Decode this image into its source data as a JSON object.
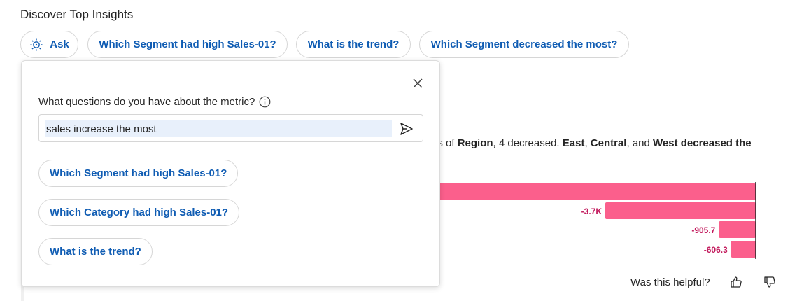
{
  "heading": "Discover Top Insights",
  "chips": {
    "ask": "Ask",
    "q1": "Which Segment had high Sales-01?",
    "q2": "What is the trend?",
    "q3": "Which Segment decreased the most?"
  },
  "popover": {
    "question_label": "What questions do you have about the metric?",
    "input_value": "sales increase the most",
    "suggestions": [
      "Which Segment had high Sales-01?",
      "Which Category had high Sales-01?",
      "What is the trend?"
    ]
  },
  "summary": {
    "pre": "ers of ",
    "region": "Region",
    "mid": ", 4 decreased. ",
    "east": "East",
    "comma1": ", ",
    "central": "Central",
    "and": ", and ",
    "west": "West decreased the"
  },
  "chart_data": {
    "type": "bar",
    "orientation": "horizontal",
    "values": [
      null,
      -3700,
      -905.7,
      -606.3
    ],
    "value_labels": [
      "",
      "-3.7K",
      "-905.7",
      "-606.3"
    ],
    "bar_color": "#fb5f8c",
    "label_color": "#c2185b"
  },
  "footer": {
    "helpful": "Was this helpful?"
  },
  "colors": {
    "accent": "#0f5cb3",
    "bar": "#fb5f8c"
  }
}
